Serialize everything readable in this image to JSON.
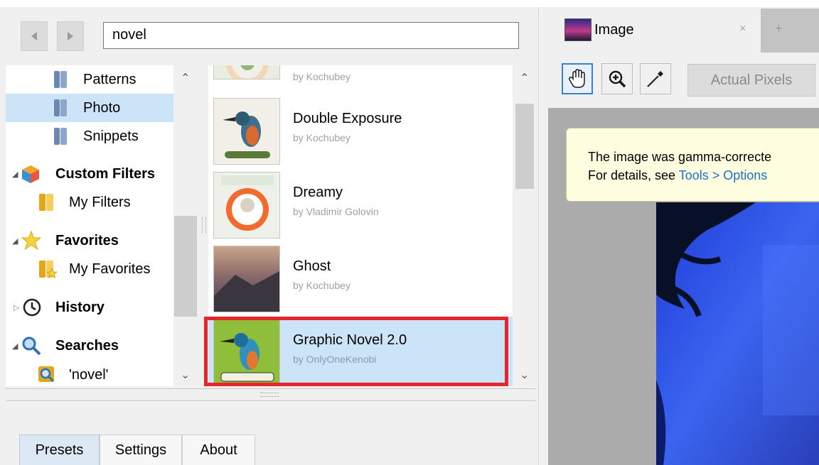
{
  "search": {
    "value": "novel"
  },
  "tree": {
    "items": [
      {
        "label": "Patterns"
      },
      {
        "label": "Photo"
      },
      {
        "label": "Snippets"
      },
      {
        "label": "Custom Filters"
      },
      {
        "label": "My Filters"
      },
      {
        "label": "Favorites"
      },
      {
        "label": "My Favorites"
      },
      {
        "label": "History"
      },
      {
        "label": "Searches"
      },
      {
        "label": "'novel'"
      }
    ]
  },
  "presets": [
    {
      "name": "Double Exposure",
      "author": "by Kochubey"
    },
    {
      "name": "Dreamy",
      "author": "by Vladimir Golovin"
    },
    {
      "name": "Ghost",
      "author": "by Kochubey"
    },
    {
      "name": "Graphic Novel 2.0",
      "author": "by OnlyOneKenobi",
      "selected": true
    }
  ],
  "bottom_tabs": [
    {
      "label": "Presets",
      "active": true
    },
    {
      "label": "Settings"
    },
    {
      "label": "About"
    }
  ],
  "image_tab": {
    "title": "Image",
    "close_glyph": "×",
    "new_glyph": "+"
  },
  "toolbar": {
    "actual_pixels": "Actual Pixels"
  },
  "notice": {
    "line1": "The image was gamma-correcte",
    "line2_prefix": "For details, see ",
    "line2_link": "Tools > Options"
  },
  "colors": {
    "selection": "#cce4f7",
    "highlight": "#e5262d",
    "link": "#1a73c8",
    "notice_bg": "#fffde0"
  },
  "icons": [
    "back-icon",
    "forward-icon",
    "folder-icon",
    "cube-icon",
    "star-icon",
    "clock-icon",
    "magnifier-icon",
    "hand-icon",
    "zoom-icon",
    "eyedropper-icon"
  ]
}
